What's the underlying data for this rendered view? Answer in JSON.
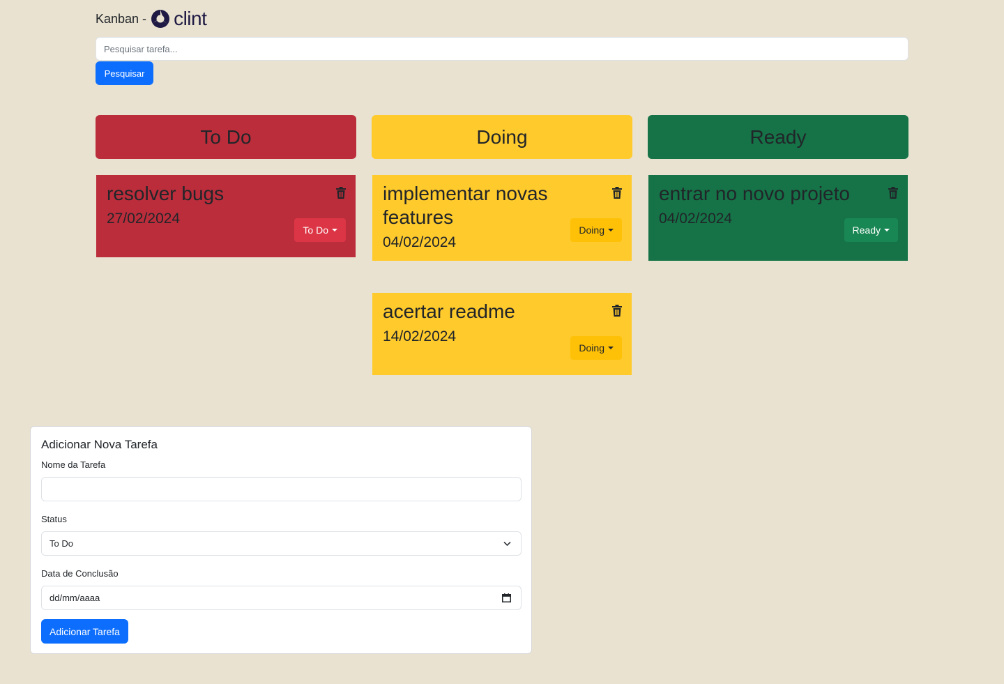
{
  "header": {
    "kanban_label": "Kanban -",
    "logo_text": "clint"
  },
  "search": {
    "placeholder": "Pesquisar tarefa...",
    "button_label": "Pesquisar"
  },
  "columns": [
    {
      "title": "To Do",
      "color": "#bb2d3b"
    },
    {
      "title": "Doing",
      "color": "#ffca2c"
    },
    {
      "title": "Ready",
      "color": "#157347"
    }
  ],
  "cards": [
    {
      "title": "resolver bugs",
      "date": "27/02/2024",
      "status": "To Do"
    },
    {
      "title": "implementar novas features",
      "date": "04/02/2024",
      "status": "Doing"
    },
    {
      "title": "entrar no novo projeto",
      "date": "04/02/2024",
      "status": "Ready"
    },
    {
      "title": "acertar readme",
      "date": "14/02/2024",
      "status": "Doing"
    }
  ],
  "form": {
    "title": "Adicionar Nova Tarefa",
    "name_label": "Nome da Tarefa",
    "name_value": "",
    "status_label": "Status",
    "status_value": "To Do",
    "date_label": "Data de Conclusão",
    "date_placeholder": "dd/mm/aaaa",
    "submit_label": "Adicionar Tarefa"
  },
  "icons": {
    "trash": "trash-icon",
    "caret": "caret-down-icon",
    "chevron": "chevron-down-icon",
    "calendar": "calendar-icon"
  }
}
